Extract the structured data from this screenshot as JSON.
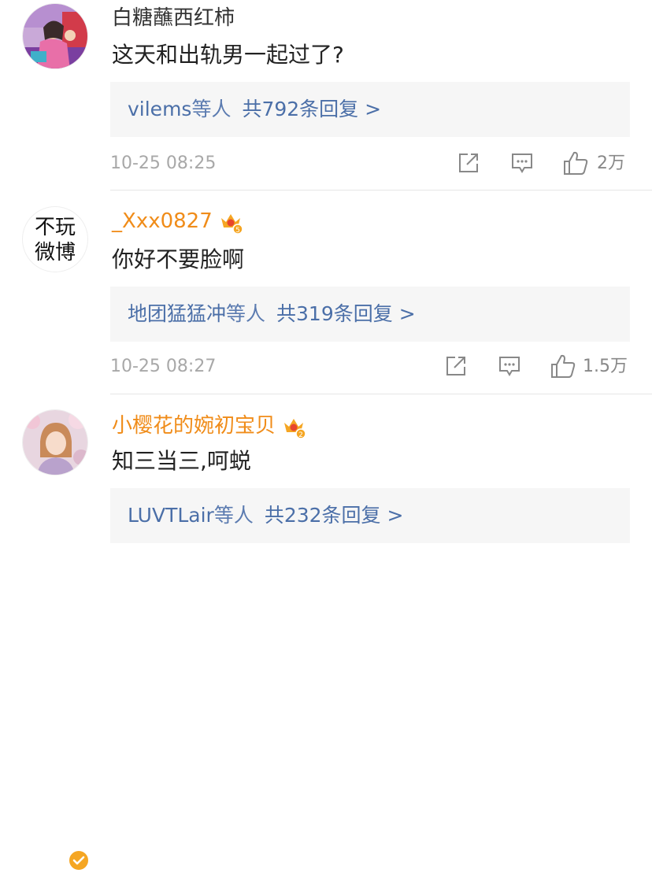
{
  "comments": [
    {
      "author": "白糖蘸西红柿",
      "text": "这天和出轨男一起过了?",
      "reply_users": "vilems",
      "reply_deng": "等人",
      "reply_count": "共792条回复 >",
      "time": "10-25 08:25",
      "likes": "2万"
    },
    {
      "author": "_Xxx0827",
      "avatar_text_line1": "不玩",
      "avatar_text_line2": "微博",
      "badge_level": "5",
      "text": "你好不要脸啊",
      "reply_users": "地团猛猛冲",
      "reply_deng": "等人",
      "reply_count": "共319条回复 >",
      "time": "10-25 08:27",
      "likes": "1.5万"
    },
    {
      "author": "小樱花的婉初宝贝",
      "badge_level": "2",
      "text": "知三当三,呵蜕",
      "reply_users": "LUVTLair",
      "reply_deng": "等人",
      "reply_count": "共232条回复 >",
      "verified": true
    }
  ],
  "icons": {
    "share": "share-icon",
    "comment": "comment-icon",
    "like": "thumbs-up-icon",
    "vip": "crown-icon",
    "verified": "verified-badge-icon"
  },
  "colors": {
    "vip_name": "#f08c19",
    "reply_link": "#4b6fa8",
    "reply_bg": "#f6f6f6",
    "meta_gray": "#a8a8a8"
  }
}
